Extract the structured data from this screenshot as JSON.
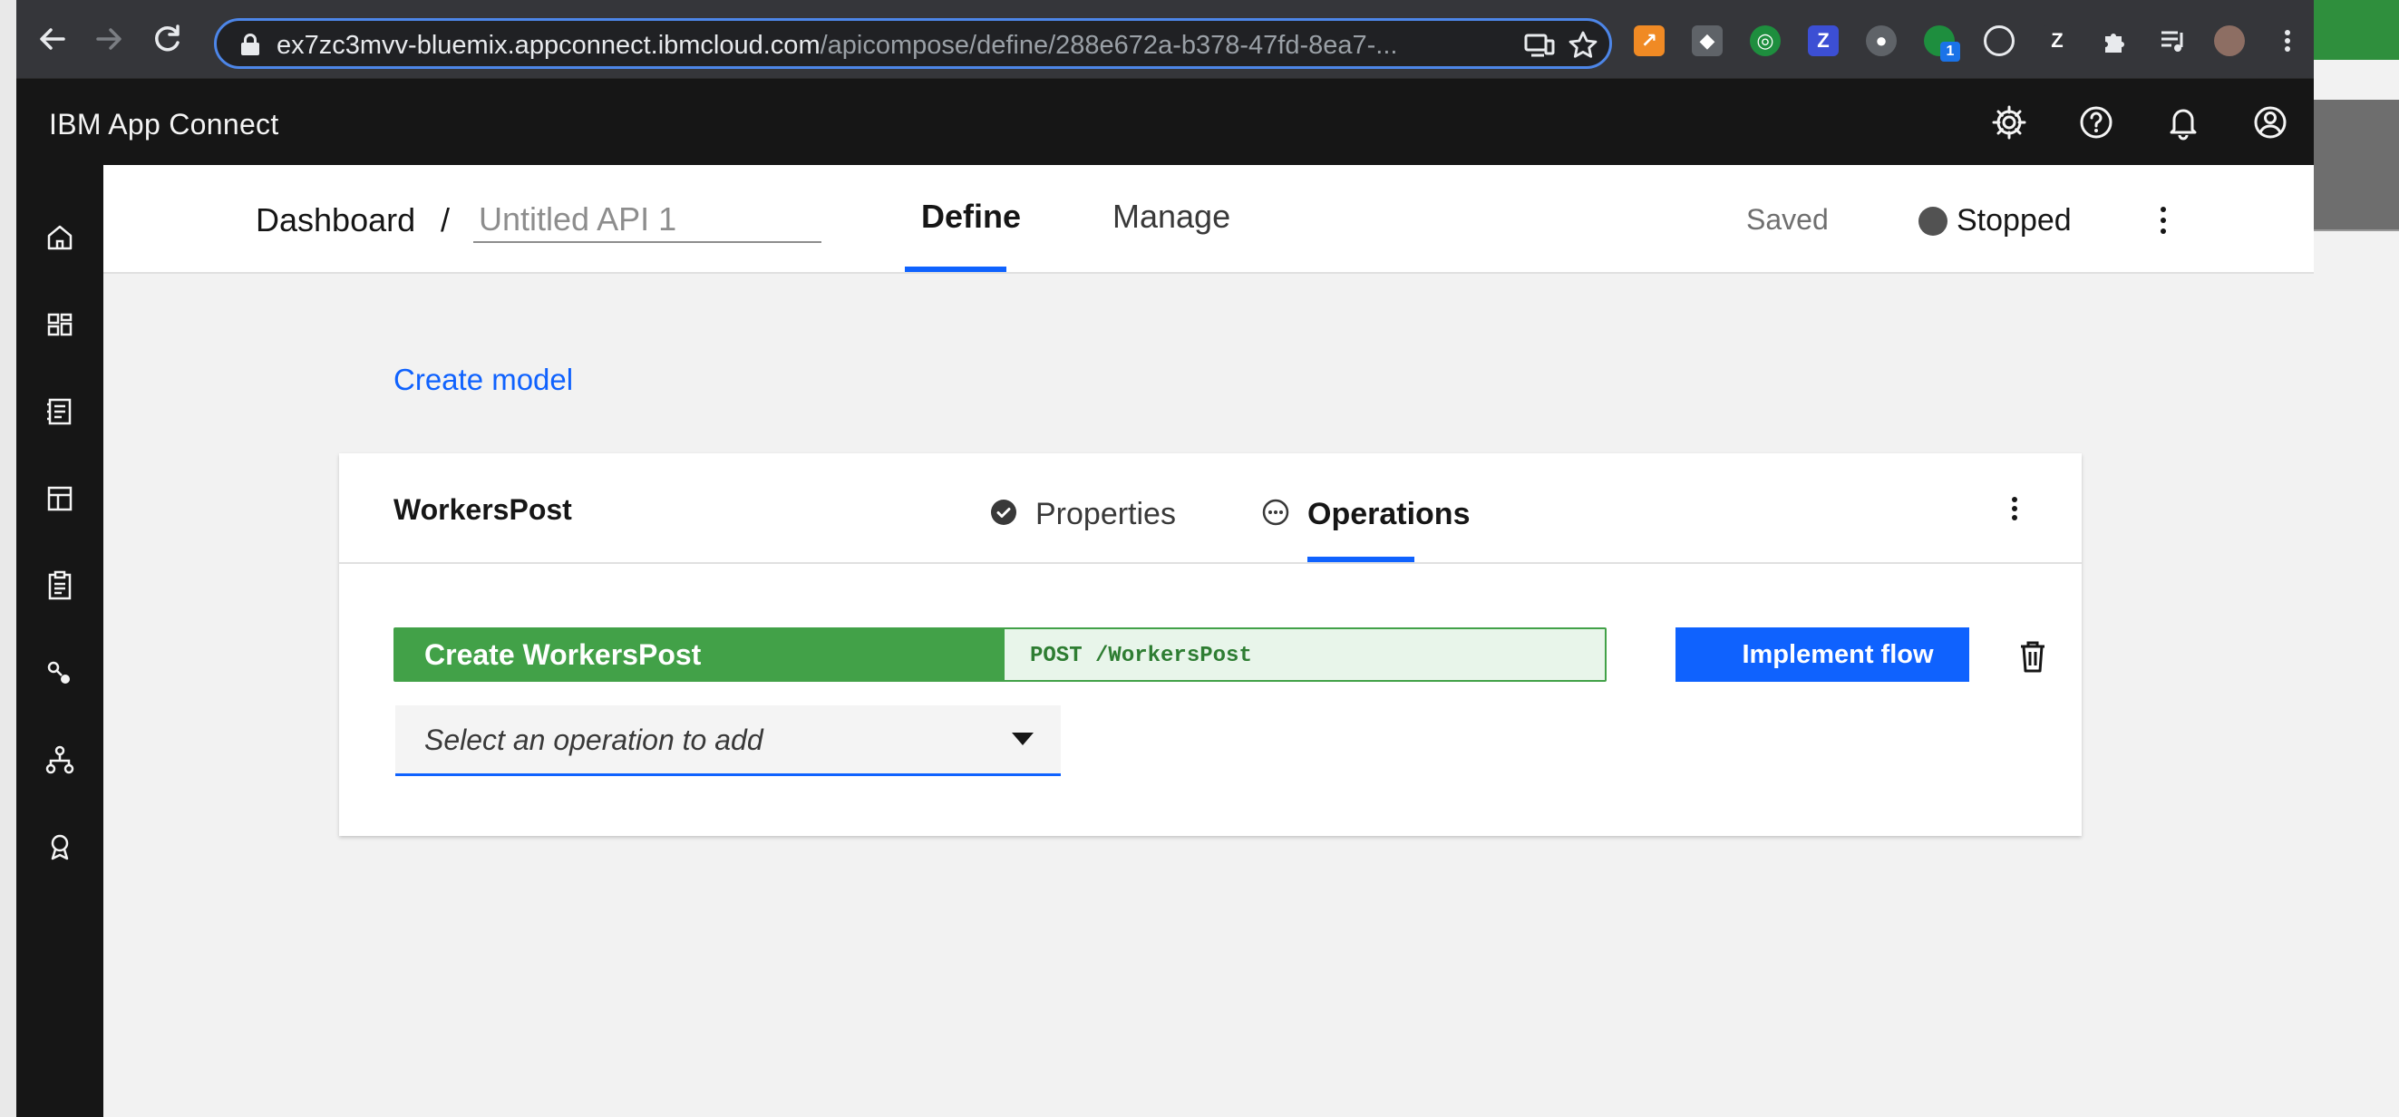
{
  "browser": {
    "url_host": "ex7zc3mvv-bluemix.appconnect.ibmcloud.com",
    "url_path": "/apicompose/define/288e672a-b378-47fd-8ea7-...",
    "icons": [
      "back-icon",
      "forward-icon",
      "reload-icon",
      "lock-icon",
      "cast-icon",
      "star-icon",
      "extensions-icon",
      "media-icon",
      "menu-icon"
    ],
    "extensions": [
      {
        "name": "chart-extension-icon",
        "color": "#f08a24",
        "glyph": "↗"
      },
      {
        "name": "roblox-extension-icon",
        "color": "#5f6368",
        "glyph": "◆"
      },
      {
        "name": "target-extension-icon",
        "color": "#1e8e3e",
        "glyph": "◎"
      },
      {
        "name": "zotero-extension-icon",
        "color": "#3c4fd4",
        "glyph": "Z"
      },
      {
        "name": "circle-extension-icon",
        "color": "#5f6368",
        "glyph": "●"
      },
      {
        "name": "green-extension-icon",
        "color": "#1e8e3e",
        "glyph": "●"
      },
      {
        "name": "dots-extension-icon",
        "color": "#35363a",
        "glyph": "⊙"
      },
      {
        "name": "z-extension-icon",
        "color": "#35363a",
        "glyph": "Z"
      }
    ],
    "extension_badge": "1"
  },
  "app": {
    "brand": "IBM App Connect",
    "header_icons": [
      "settings-icon",
      "help-icon",
      "notification-icon",
      "user-icon"
    ],
    "sidenav_icons": [
      "home-icon",
      "dashboard-icon",
      "catalog-icon",
      "templates-icon",
      "clipboard-icon",
      "connections-icon",
      "network-icon",
      "badge-icon"
    ]
  },
  "subheader": {
    "breadcrumb": "Dashboard",
    "separator": "/",
    "api_name_placeholder": "Untitled API 1",
    "tabs": [
      "Define",
      "Manage"
    ],
    "active_tab": "Define",
    "save_status": "Saved",
    "run_status": "Stopped"
  },
  "main": {
    "create_model": "Create model",
    "model": {
      "name": "WorkersPost",
      "tabs": [
        "Properties",
        "Operations"
      ],
      "active_tab": "Operations",
      "operations": [
        {
          "name": "Create WorkersPost",
          "path": "POST /WorkersPost"
        }
      ],
      "implement_label": "Implement flow",
      "select_placeholder": "Select an operation to add"
    }
  },
  "colors": {
    "accent": "#0f62fe",
    "operation_green": "#42a148",
    "header_dark": "#161616"
  }
}
